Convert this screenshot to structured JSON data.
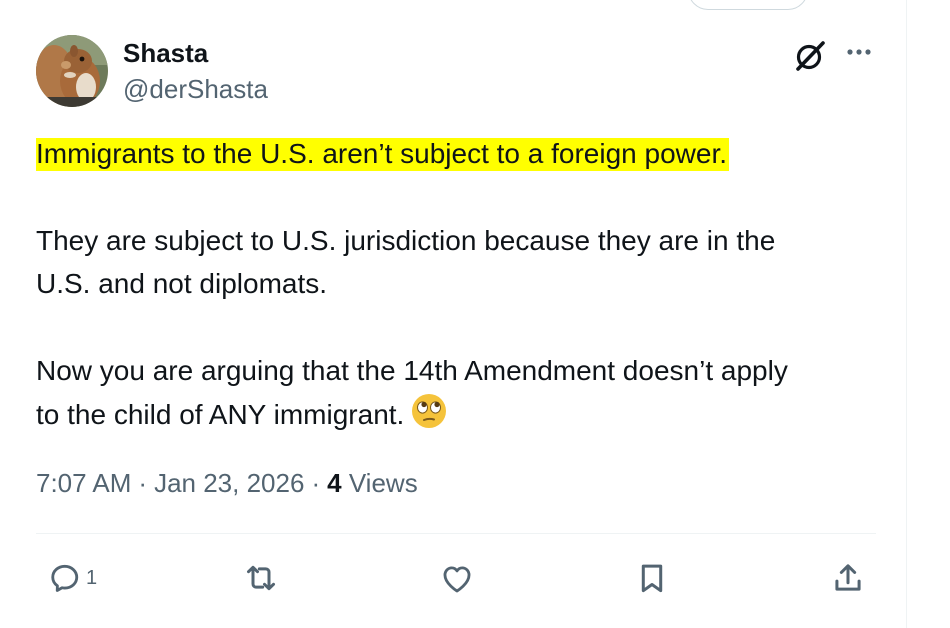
{
  "author": {
    "display_name": "Shasta",
    "handle": "@derShasta"
  },
  "tweet": {
    "highlighted_line": "Immigrants to the U.S. aren’t subject to a foreign power.",
    "paragraph2_line1": "They are subject to U.S. jurisdiction because they are in the",
    "paragraph2_line2": "U.S. and not diplomats.",
    "paragraph3_line1": "Now you are arguing that the 14th Amendment doesn’t apply",
    "paragraph3_line2": "to the child of ANY immigrant.",
    "emoji": "face-with-rolling-eyes",
    "highlight_color": "#ffff00"
  },
  "meta": {
    "time": "7:07 AM",
    "separator": "·",
    "date": "Jan 23, 2026",
    "views_count": "4",
    "views_label": "Views"
  },
  "actions": {
    "reply_count": "1",
    "icons": [
      "reply-icon",
      "retweet-icon",
      "like-icon",
      "bookmark-icon",
      "share-icon"
    ]
  },
  "colors": {
    "text": "#0f1419",
    "secondary": "#536471",
    "border": "#eff3f4"
  }
}
